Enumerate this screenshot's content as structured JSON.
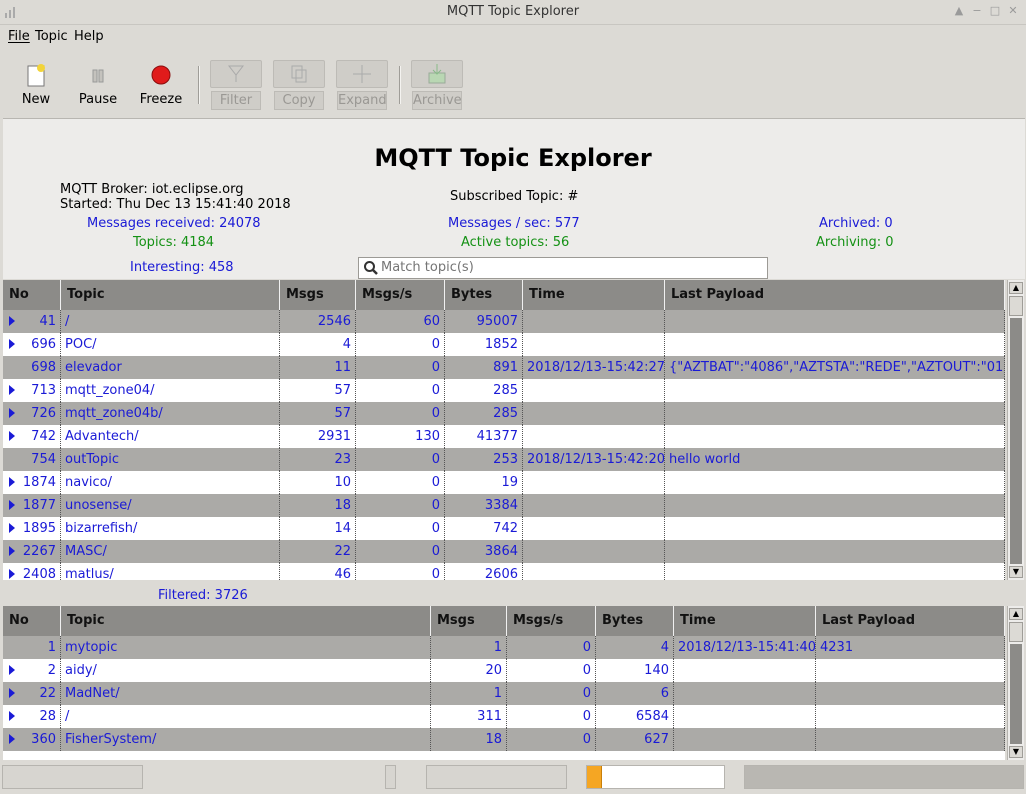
{
  "window": {
    "title": "MQTT Topic Explorer"
  },
  "menu": {
    "file": "File",
    "topic": "Topic",
    "help": "Help"
  },
  "toolbar": {
    "new": "New",
    "pause": "Pause",
    "freeze": "Freeze",
    "filter": "Filter",
    "copy": "Copy",
    "expand": "Expand",
    "archive": "Archive"
  },
  "header": {
    "app_title": "MQTT Topic Explorer",
    "broker": "MQTT Broker: iot.eclipse.org",
    "started": "Started: Thu Dec 13 15:41:40 2018",
    "subscribed": "Subscribed Topic: #",
    "messages_received": "Messages received: 24078",
    "messages_per_sec": "Messages / sec: 577",
    "archived": "Archived: 0",
    "topics": "Topics: 4184",
    "active_topics": "Active topics: 56",
    "archiving": "Archiving: 0",
    "interesting": "Interesting: 458",
    "search_placeholder": "Match topic(s)",
    "filtered": "Filtered: 3726"
  },
  "colors": {
    "info_blue": "#1a1ad6",
    "info_green": "#149114",
    "progress": "#f5a623"
  },
  "table_top": {
    "columns": [
      "No",
      "Topic",
      "Msgs",
      "Msgs/s",
      "Bytes",
      "Time",
      "Last Payload"
    ],
    "rows": [
      {
        "no": "41",
        "topic": "/",
        "msgs": "2546",
        "rate": "60",
        "bytes": "95007",
        "time": "",
        "payload": "",
        "exp": true
      },
      {
        "no": "696",
        "topic": "POC/",
        "msgs": "4",
        "rate": "0",
        "bytes": "1852",
        "time": "",
        "payload": "",
        "exp": true
      },
      {
        "no": "698",
        "topic": "elevador",
        "msgs": "11",
        "rate": "0",
        "bytes": "891",
        "time": "2018/12/13-15:42:27",
        "payload": "{\"AZTBAT\":\"4086\",\"AZTSTA\":\"REDE\",\"AZTOUT\":\"01...",
        "exp": false
      },
      {
        "no": "713",
        "topic": "mqtt_zone04/",
        "msgs": "57",
        "rate": "0",
        "bytes": "285",
        "time": "",
        "payload": "",
        "exp": true
      },
      {
        "no": "726",
        "topic": "mqtt_zone04b/",
        "msgs": "57",
        "rate": "0",
        "bytes": "285",
        "time": "",
        "payload": "",
        "exp": true
      },
      {
        "no": "742",
        "topic": "Advantech/",
        "msgs": "2931",
        "rate": "130",
        "bytes": "41377",
        "time": "",
        "payload": "",
        "exp": true
      },
      {
        "no": "754",
        "topic": "outTopic",
        "msgs": "23",
        "rate": "0",
        "bytes": "253",
        "time": "2018/12/13-15:42:20",
        "payload": "hello world",
        "exp": false
      },
      {
        "no": "1874",
        "topic": "navico/",
        "msgs": "10",
        "rate": "0",
        "bytes": "19",
        "time": "",
        "payload": "",
        "exp": true
      },
      {
        "no": "1877",
        "topic": "unosense/",
        "msgs": "18",
        "rate": "0",
        "bytes": "3384",
        "time": "",
        "payload": "",
        "exp": true
      },
      {
        "no": "1895",
        "topic": "bizarrefish/",
        "msgs": "14",
        "rate": "0",
        "bytes": "742",
        "time": "",
        "payload": "",
        "exp": true
      },
      {
        "no": "2267",
        "topic": "MASC/",
        "msgs": "22",
        "rate": "0",
        "bytes": "3864",
        "time": "",
        "payload": "",
        "exp": true
      },
      {
        "no": "2408",
        "topic": "matlus/",
        "msgs": "46",
        "rate": "0",
        "bytes": "2606",
        "time": "",
        "payload": "",
        "exp": true
      }
    ]
  },
  "table_bottom": {
    "columns": [
      "No",
      "Topic",
      "Msgs",
      "Msgs/s",
      "Bytes",
      "Time",
      "Last Payload"
    ],
    "rows": [
      {
        "no": "1",
        "topic": "mytopic",
        "msgs": "1",
        "rate": "0",
        "bytes": "4",
        "time": "2018/12/13-15:41:40",
        "payload": "4231",
        "exp": false
      },
      {
        "no": "2",
        "topic": "aidy/",
        "msgs": "20",
        "rate": "0",
        "bytes": "140",
        "time": "",
        "payload": "",
        "exp": true
      },
      {
        "no": "22",
        "topic": "MadNet/",
        "msgs": "1",
        "rate": "0",
        "bytes": "6",
        "time": "",
        "payload": "",
        "exp": true
      },
      {
        "no": "28",
        "topic": "/",
        "msgs": "311",
        "rate": "0",
        "bytes": "6584",
        "time": "",
        "payload": "",
        "exp": true
      },
      {
        "no": "360",
        "topic": "FisherSystem/",
        "msgs": "18",
        "rate": "0",
        "bytes": "627",
        "time": "",
        "payload": "",
        "exp": true
      }
    ]
  },
  "statusbar": {
    "progress_fraction": 0.1
  }
}
